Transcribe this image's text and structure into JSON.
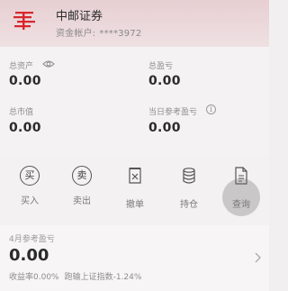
{
  "header": {
    "broker_name": "中邮证券",
    "account_label": "资金帐户:",
    "account_number": "****3972"
  },
  "assets": {
    "total_assets_label": "总资产",
    "total_assets_value": "0.00",
    "total_pnl_label": "总盈亏",
    "total_pnl_value": "0.00",
    "market_value_label": "总市值",
    "market_value_value": "0.00",
    "daily_pnl_label": "当日参考盈亏",
    "daily_pnl_value": "0.00",
    "info_glyph": "i"
  },
  "actions": [
    {
      "label": "买入",
      "glyph": "买",
      "icon": "buy-icon"
    },
    {
      "label": "卖出",
      "glyph": "卖",
      "icon": "sell-icon"
    },
    {
      "label": "撤单",
      "icon": "cancel-order-icon"
    },
    {
      "label": "持仓",
      "icon": "positions-icon"
    },
    {
      "label": "查询",
      "icon": "query-icon"
    }
  ],
  "monthly": {
    "title": "4月参考盈亏",
    "value": "0.00",
    "return_rate": "收益率0.00%",
    "benchmark": "跑输上证指数-1.24%"
  },
  "colors": {
    "brand_red": "#d8262b",
    "header_bg": "#e7cfd2"
  }
}
